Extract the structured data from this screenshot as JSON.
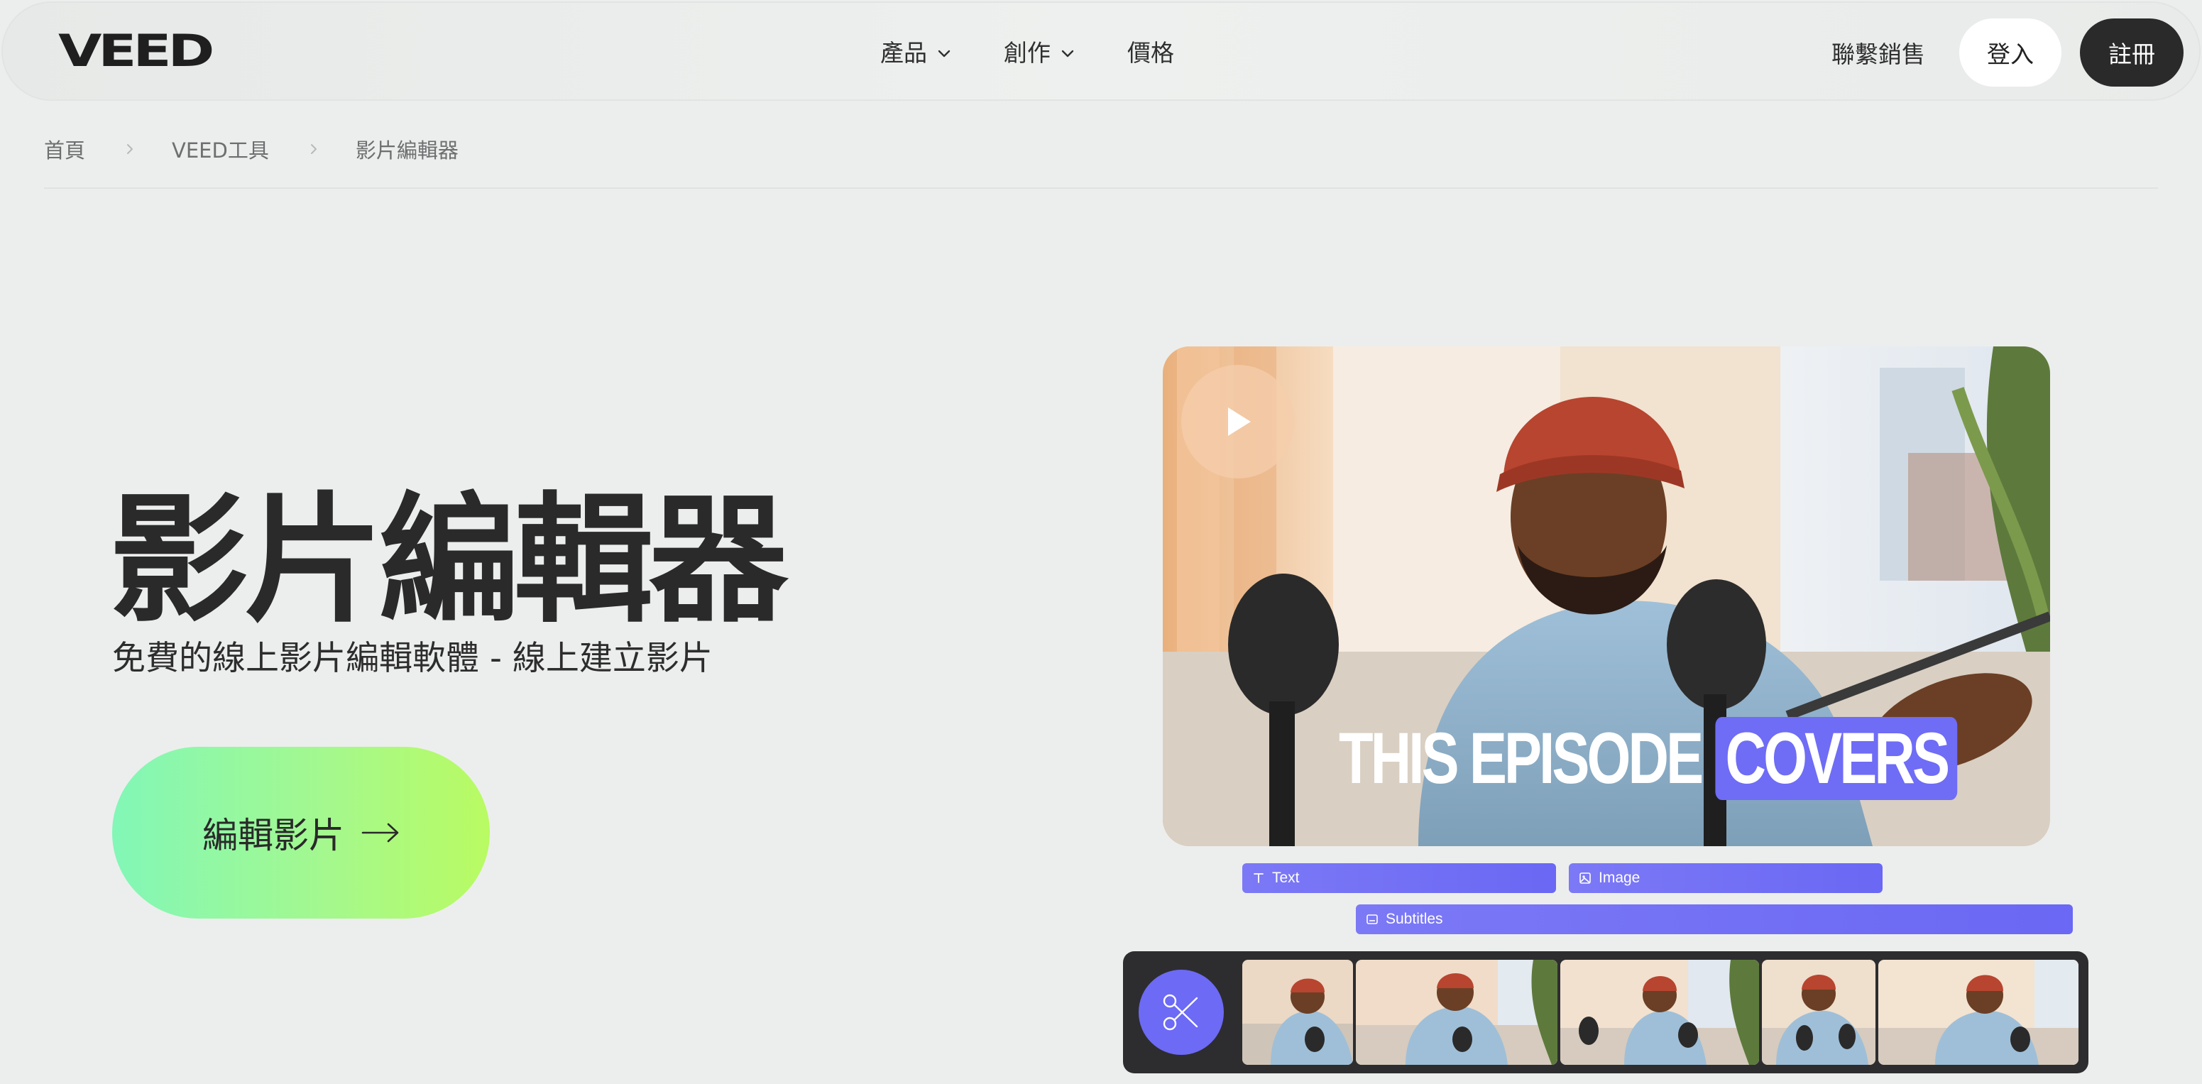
{
  "brand": {
    "logo_text": "VEED",
    "accent": "#6d6af5",
    "cta_gradient": [
      "#82f7b7",
      "#b9fb62"
    ]
  },
  "nav": {
    "items": [
      {
        "label": "產品",
        "has_dropdown": true,
        "icon": "chevron-down-icon"
      },
      {
        "label": "創作",
        "has_dropdown": true,
        "icon": "chevron-down-icon"
      },
      {
        "label": "價格",
        "has_dropdown": false
      }
    ],
    "contact_label": "聯繫銷售",
    "login_label": "登入",
    "signup_label": "註冊"
  },
  "breadcrumb": [
    {
      "label": "首頁"
    },
    {
      "label": "VEED工具"
    },
    {
      "label": "影片編輯器"
    }
  ],
  "hero": {
    "title": "影片編輯器",
    "subtitle": "免費的線上影片編輯軟體 - 線上建立影片",
    "cta_label": "編輯影片",
    "cta_icon": "arrow-right-icon"
  },
  "video": {
    "play_icon": "play-icon",
    "caption_main": "THIS EPISODE",
    "caption_highlight": "COVERS",
    "caption_highlight_color": "#6f6cf6"
  },
  "tracks": [
    {
      "label": "Text",
      "icon": "text-icon"
    },
    {
      "label": "Image",
      "icon": "image-icon"
    },
    {
      "label": "Subtitles",
      "icon": "subtitles-icon"
    }
  ],
  "timeline": {
    "cut_icon": "scissors-icon",
    "frame_count": 5
  }
}
